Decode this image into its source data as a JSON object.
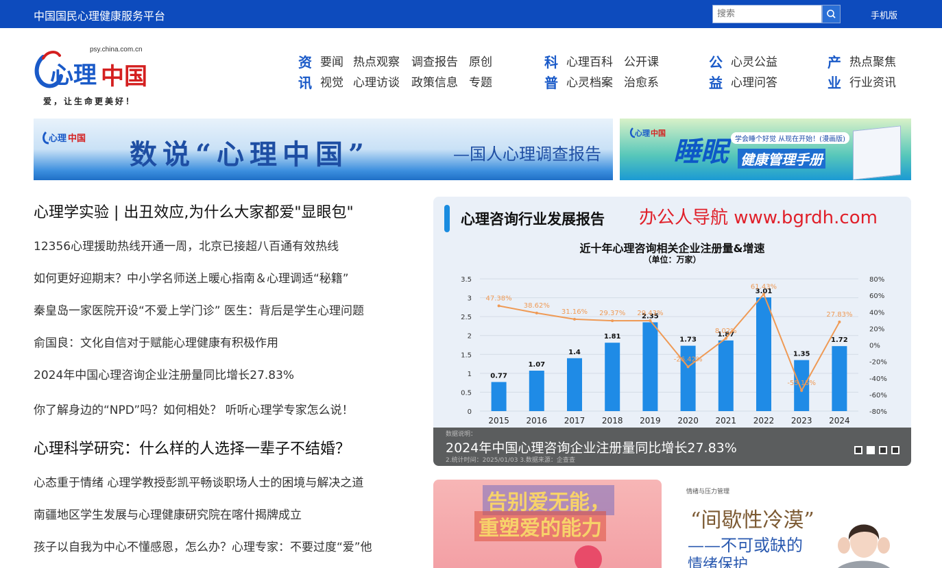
{
  "topbar": {
    "site_title": "中国国民心理健康服务平台",
    "search_placeholder": "搜索",
    "mobile_label": "手机版",
    "brand_color": "#0d4bbd"
  },
  "logo": {
    "url_text": "psy.china.com.cn",
    "slogan": "爱，让生命更美好！"
  },
  "nav": [
    {
      "cat": [
        "资",
        "讯"
      ],
      "row1": [
        "要闻",
        "热点观察",
        "调查报告",
        "原创"
      ],
      "row2": [
        "视觉",
        "心理访谈",
        "政策信息",
        "专题"
      ]
    },
    {
      "cat": [
        "科",
        "普"
      ],
      "row1": [
        "心理百科",
        "公开课"
      ],
      "row2": [
        "心灵档案",
        "治愈系"
      ]
    },
    {
      "cat": [
        "公",
        "益"
      ],
      "row1": [
        "心灵公益"
      ],
      "row2": [
        "心理问答"
      ]
    },
    {
      "cat": [
        "产",
        "业"
      ],
      "row1": [
        "热点聚焦"
      ],
      "row2": [
        "行业资讯"
      ]
    }
  ],
  "banners": {
    "left_title": "数说“心理中国”",
    "left_sub": "—国人心理调查报告",
    "right_big": "睡眠",
    "right_small": "健康管理手册",
    "right_tag": "学会睡个好觉 从现在开始！(漫画版)"
  },
  "news": {
    "headline1": "心理学实验 | 出丑效应,为什么大家都爱\"显眼包\"",
    "group1": [
      "12356心理援助热线开通一周，北京已接超八百通有效热线",
      "如何更好迎期末？中小学名师送上暖心指南＆心理调适“秘籍”",
      "秦皇岛一家医院开设“不爱上学门诊” 医生：背后是学生心理问题",
      "俞国良：文化自信对于赋能心理健康有积极作用",
      "2024年中国心理咨询企业注册量同比增长27.83%",
      "你了解身边的“NPD”吗？如何相处？ 听听心理学专家怎么说！"
    ],
    "headline2": "心理科学研究：什么样的人选择一辈子不结婚？",
    "group2": [
      "心态重于情绪 心理学教授彭凯平畅谈职场人士的困境与解决之道",
      "南疆地区学生发展与心理健康研究院在喀什揭牌成立",
      "孩子以自我为中心不懂感恩，怎么办？心理专家：不要过度“爱”他"
    ]
  },
  "slide": {
    "report_title": "心理咨询行业发展报告",
    "watermark": "办公人导航 www.bgrdh.com",
    "caption": "2024年中国心理咨询企业注册量同比增长27.83%",
    "note1": "数据说明：",
    "note2": "2.统计时间：2025/01/03  3.数据来源：企查查"
  },
  "chart_data": {
    "type": "bar",
    "title": "近十年心理咨询相关企业注册量&增速",
    "subtitle": "（单位：万家）",
    "categories": [
      "2015",
      "2016",
      "2017",
      "2018",
      "2019",
      "2020",
      "2021",
      "2022",
      "2023",
      "2024"
    ],
    "series": [
      {
        "values": [
          0.77,
          1.07,
          1.4,
          1.81,
          2.35,
          1.73,
          1.87,
          3.01,
          1.35,
          1.72
        ],
        "color": "#1f8be6"
      },
      {
        "values": [
          47.38,
          38.62,
          31.16,
          29.37,
          29.43,
          -26.42,
          8.02,
          61.43,
          -55.15,
          27.83
        ],
        "color": "#ef9a55"
      }
    ],
    "growth_labels": [
      "47.38%",
      "38.62%",
      "31.16%",
      "29.37%",
      "29.43%",
      "-26.42%",
      "8.02%",
      "61.43%",
      "-55.15%",
      "27.83%"
    ],
    "ylim_left": [
      0,
      3.5
    ],
    "yticks_left": [
      "0",
      "0.5",
      "1",
      "1.5",
      "2",
      "2.5",
      "3",
      "3.5"
    ],
    "ylim_right": [
      -80,
      80
    ],
    "yticks_right": [
      "-80%",
      "-60%",
      "-40%",
      "-20%",
      "0%",
      "20%",
      "40%",
      "60%",
      "80%"
    ],
    "grid": true
  },
  "tiles": {
    "tile1_line1": "告别爱无能，",
    "tile1_line2": "重塑爱的能力",
    "tile2_small": "情绪与压力管理",
    "tile2_big": "“间歇性冷漠”",
    "tile2_line2": "——不可或缺的",
    "tile2_line3": "情绪保护"
  }
}
